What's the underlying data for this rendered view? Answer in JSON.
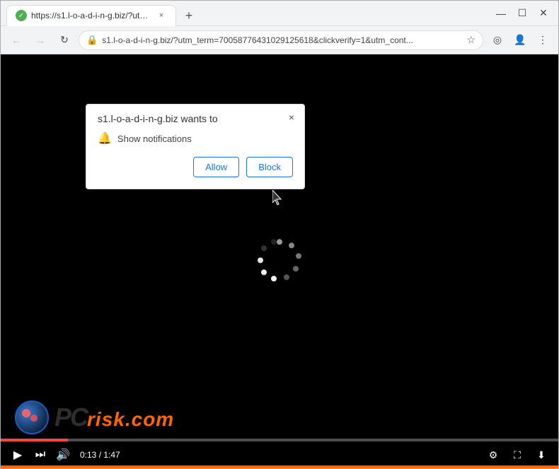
{
  "browser": {
    "tab": {
      "favicon_symbol": "✓",
      "title": "https://s1.l-o-a-d-i-n-g.biz/?utm...",
      "close_symbol": "×"
    },
    "new_tab_symbol": "+",
    "window_controls": {
      "minimize": "—",
      "maximize": "☐",
      "close": "✕"
    },
    "address_bar": {
      "back_symbol": "←",
      "forward_symbol": "→",
      "reload_symbol": "↻",
      "lock_symbol": "🔒",
      "url": "s1.l-o-a-d-i-n-g.biz/?utm_term=70058776431029125618&clickverify=1&utm_cont...",
      "star_symbol": "☆",
      "profile_symbol": "👤",
      "menu_symbol": "⋮",
      "extensions_symbol": "◎"
    }
  },
  "notification_dialog": {
    "site": "s1.l-o-a-d-i-n-g.biz wants to",
    "permission_bell": "🔔",
    "permission_text": "Show notifications",
    "allow_label": "Allow",
    "block_label": "Block",
    "close_symbol": "×"
  },
  "video": {
    "time_current": "0:13",
    "time_total": "1:47",
    "play_symbol": "▶",
    "skip_symbol": "⏭",
    "volume_symbol": "🔊",
    "settings_symbol": "⚙",
    "fullscreen_symbol": "⛶",
    "download_symbol": "⬇"
  },
  "pcrisk": {
    "logo_text": "PC",
    "risk_text": "risk.com"
  },
  "spinner_dots": [
    0,
    1,
    2,
    3,
    4,
    5,
    6,
    7,
    8,
    9,
    10,
    11
  ]
}
